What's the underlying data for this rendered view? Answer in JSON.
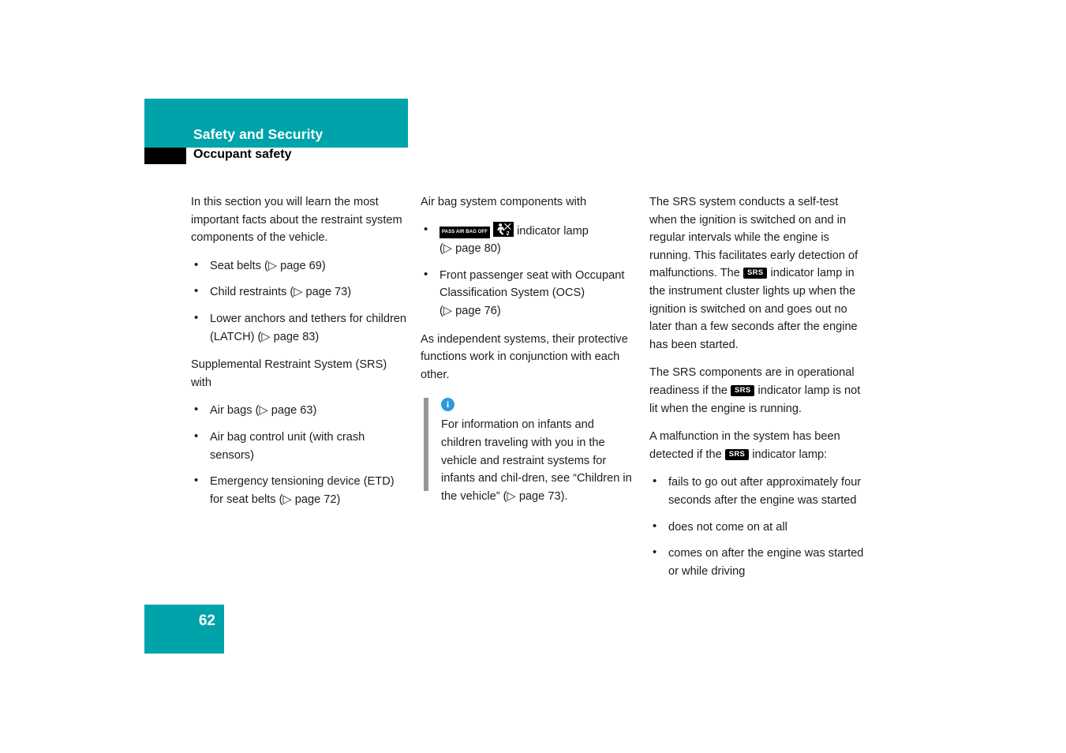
{
  "header": {
    "title": "Safety and Security",
    "subtitle": "Occupant safety",
    "accent_color": "#00a3aa",
    "swatch_color": "#000000"
  },
  "column1": {
    "intro": "In this section you will learn the most important facts about the restraint system components of the vehicle.",
    "list1": [
      "Seat belts (▷ page 69)",
      "Child restraints (▷ page 73)",
      "Lower anchors and tethers for children (LATCH) (▷ page 83)"
    ],
    "heading2": "Supplemental Restraint System (SRS) with",
    "list2": [
      "Air bags (▷ page 63)",
      "Air bag control unit (with crash sensors)",
      "Emergency tensioning device (ETD) for seat belts (▷ page 72)"
    ]
  },
  "column2": {
    "heading": "Air bag system components with",
    "item1_badge_text": "PASS AIR BAG OFF",
    "item1_label": "indicator lamp",
    "item1_ref": "(▷ page 80)",
    "item2_text": "Front passenger seat with Occupant Classification System (OCS)",
    "item2_ref": "(▷ page 76)",
    "para": "As independent systems, their protective functions work in conjunction with each other.",
    "info_icon_glyph": "i",
    "info_icon_color": "#2d9ada",
    "info_text": "For information on infants and children traveling with you in the vehicle and restraint systems for infants and chil-dren, see “Children in the vehicle” (▷ page 73)."
  },
  "column3": {
    "para1_part1": "The SRS system conducts a self-test when the ignition is switched on and in regular intervals while the engine is running. This facilitates early detection of malfunctions. The",
    "srs_badge": "SRS",
    "para1_part2": "indicator lamp in the instrument cluster lights up when the ignition is switched on and goes out no later than a few seconds after the engine has been started.",
    "para2_part1": "The SRS components are in operational readiness if the",
    "para2_part2": "indicator lamp is not lit when the engine is running.",
    "para3_part1": "A malfunction in the system has been detected if the",
    "para3_part2": "indicator lamp:",
    "list": [
      "fails to go out after approximately four seconds after the engine was started",
      "does not come on at all",
      "comes on after the engine was started or while driving"
    ]
  },
  "footer": {
    "page_number": "62"
  }
}
